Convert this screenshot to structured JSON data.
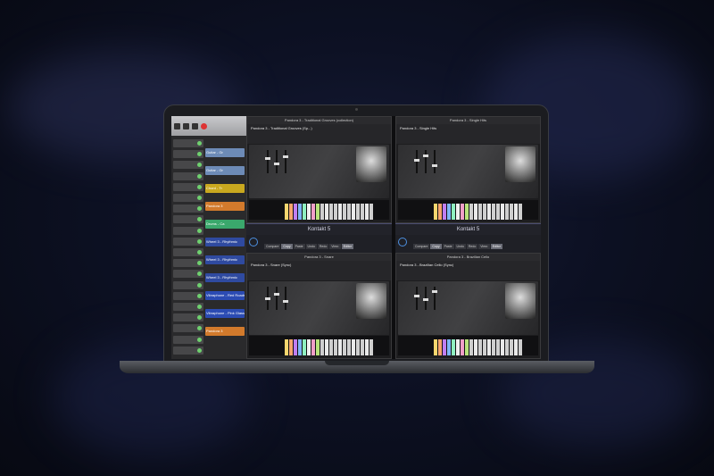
{
  "colors": {
    "accent": "#4d8fe0"
  },
  "daw": {
    "regions": [
      {
        "label": "Guitar - Gr",
        "color": "#6d8bb7"
      },
      {
        "label": "Guitar - Gr",
        "color": "#6d8bb7"
      },
      {
        "label": "Chord - Tr",
        "color": "#c9a81f"
      },
      {
        "label": "Pandora 3",
        "color": "#d27a2c"
      },
      {
        "label": "Drums - Ca",
        "color": "#3aa86c"
      },
      {
        "label": "Wheel 3 - Rhythmic",
        "color": "#2f4aa0"
      },
      {
        "label": "Wheel 3 - Rhythmic",
        "color": "#2f4aa0"
      },
      {
        "label": "Wheel 3 - Rhythmic",
        "color": "#2f4aa0"
      },
      {
        "label": "Vibraphone - Red Roads",
        "color": "#2b4bb3"
      },
      {
        "label": "Vibraphone - Pink Glass",
        "color": "#2b4bb3"
      },
      {
        "label": "Pandora 3",
        "color": "#d27a2c"
      }
    ]
  },
  "panels": [
    {
      "title": "Pandora 3 - Traditional Grooves (collection)",
      "instrument": "Pandora 3 - Traditional Grooves (Sp...)"
    },
    {
      "title": "Pandora 3 - Single Hits",
      "instrument": "Pandora 3 - Single Hits"
    },
    {
      "title": "Pandora 3 - Snare",
      "instrument": "Pandora 3 - Snare (Sync)"
    },
    {
      "title": "Pandora 3 - Brazilian Cello",
      "instrument": "Pandora 3 - Brazilian Cello (Sync)"
    }
  ],
  "kontakt": {
    "label": "Kontakt 5"
  },
  "toolbar": {
    "buttons": [
      "Compare",
      "Copy",
      "Paste",
      "Undo",
      "Redo"
    ],
    "view": "View:",
    "editor": "Editor"
  }
}
